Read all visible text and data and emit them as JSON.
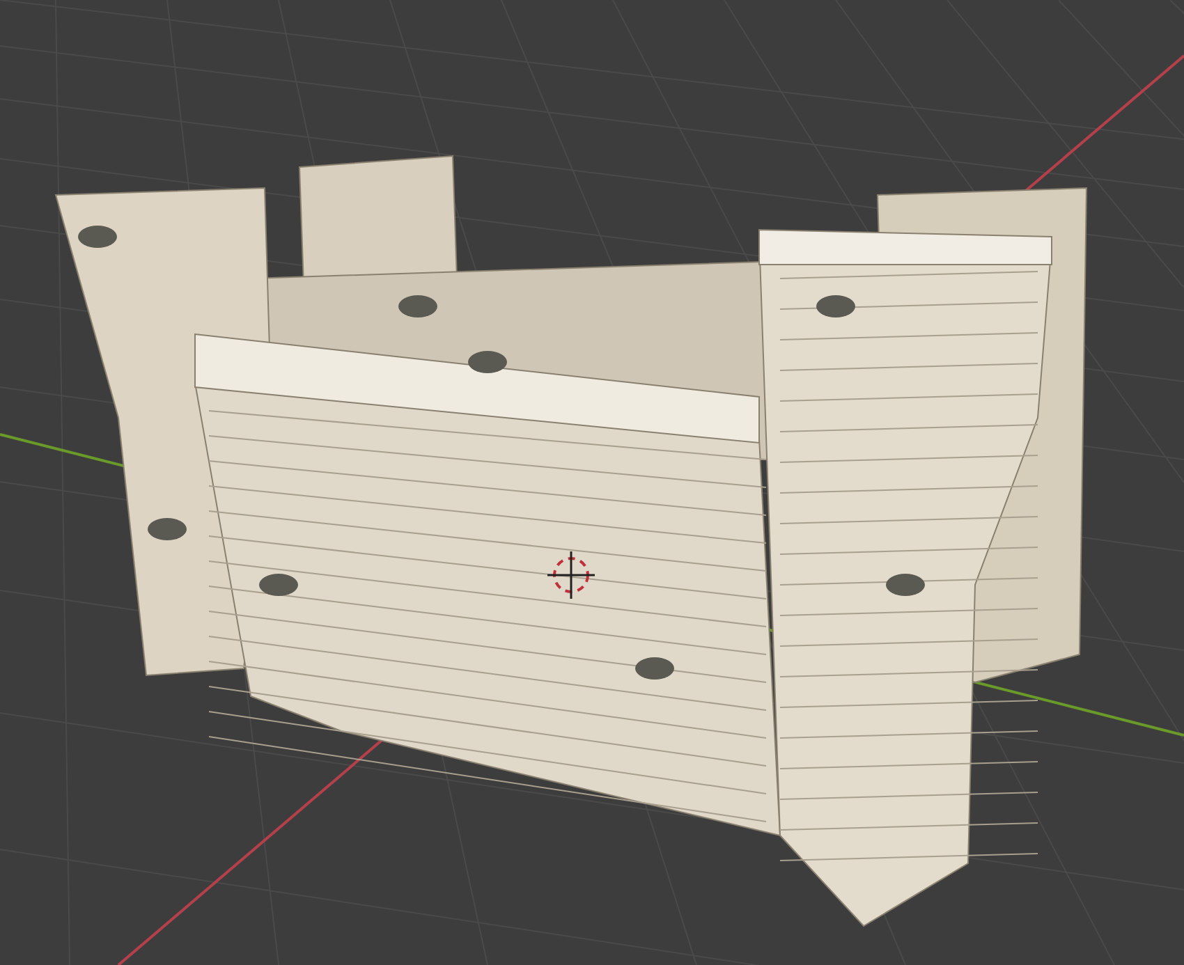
{
  "viewport": {
    "grid": true,
    "cursor_3d": true,
    "axes": [
      {
        "kind": "x",
        "color": "#b3404a"
      },
      {
        "kind": "y",
        "color": "#6a9a2a"
      }
    ]
  }
}
